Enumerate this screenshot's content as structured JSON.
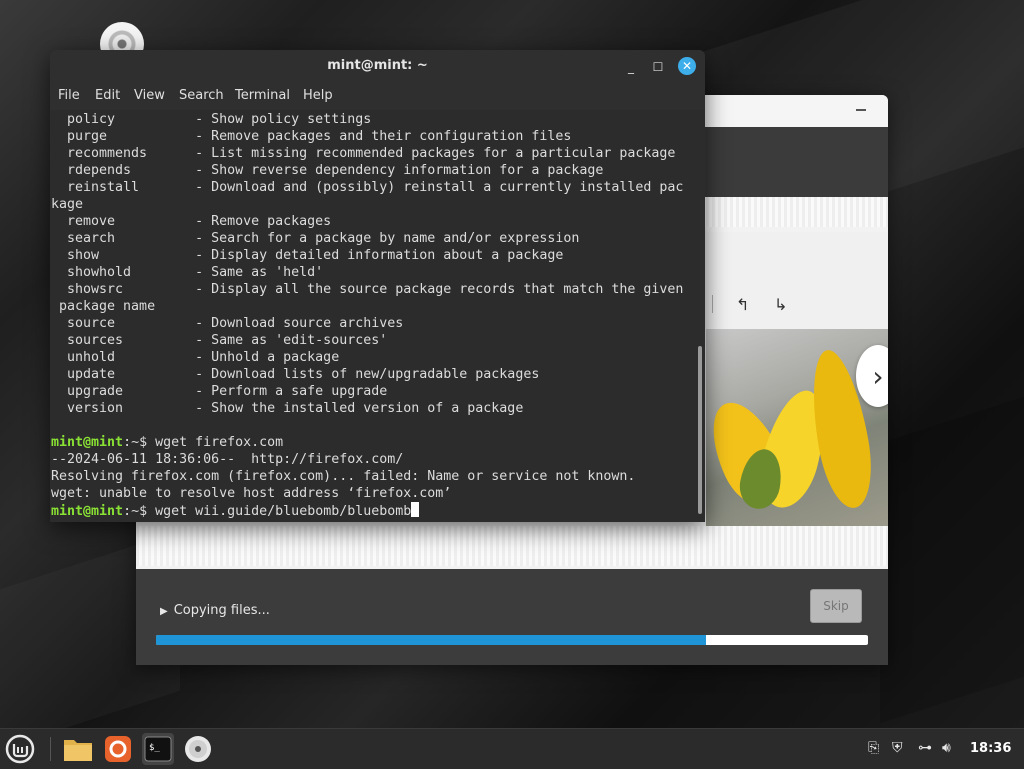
{
  "terminal": {
    "title": "mint@mint: ~",
    "menu": [
      "File",
      "Edit",
      "View",
      "Search",
      "Terminal",
      "Help"
    ],
    "lines": [
      "  policy          - Show policy settings",
      "  purge           - Remove packages and their configuration files",
      "  recommends      - List missing recommended packages for a particular package",
      "  rdepends        - Show reverse dependency information for a package",
      "  reinstall       - Download and (possibly) reinstall a currently installed pac",
      "kage",
      "  remove          - Remove packages",
      "  search          - Search for a package by name and/or expression",
      "  show            - Display detailed information about a package",
      "  showhold        - Same as 'held'",
      "  showsrc         - Display all the source package records that match the given",
      " package name",
      "  source          - Download source archives",
      "  sources         - Same as 'edit-sources'",
      "  unhold          - Unhold a package",
      "  update          - Download lists of new/upgradable packages",
      "  upgrade         - Perform a safe upgrade",
      "  version         - Show the installed version of a package",
      ""
    ],
    "prompt_user": "mint@mint",
    "prompt_suffix": ":~$ ",
    "cmd1": "wget firefox.com",
    "out1": "--2024-06-11 18:36:06--  http://firefox.com/",
    "out2": "Resolving firefox.com (firefox.com)... failed: Name or service not known.",
    "out3": "wget: unable to resolve host address ‘firefox.com’",
    "cmd2": "wget wii.guide/bluebomb/bluebomb"
  },
  "installer": {
    "status": "Copying files...",
    "skip_label": "Skip",
    "progress": 0.773
  },
  "taskbar": {
    "clock": "18:36",
    "apps": [
      "mint-menu-icon",
      "files-folder-icon",
      "firefox-icon",
      "terminal-icon",
      "disc-installer-icon"
    ]
  },
  "colors": {
    "prompt_green": "#8ae234",
    "progress_blue": "#1f94d6",
    "close_blue": "#3daee9"
  }
}
